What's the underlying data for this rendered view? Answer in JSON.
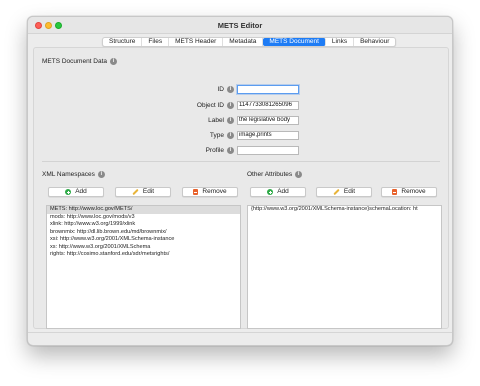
{
  "window": {
    "title": "METS Editor"
  },
  "tabs": [
    {
      "label": "Structure",
      "active": false
    },
    {
      "label": "Files",
      "active": false
    },
    {
      "label": "METS Header",
      "active": false
    },
    {
      "label": "Metadata",
      "active": false
    },
    {
      "label": "METS Document",
      "active": true
    },
    {
      "label": "Links",
      "active": false
    },
    {
      "label": "Behaviour",
      "active": false
    }
  ],
  "document_data": {
    "section_label": "METS Document Data",
    "fields": [
      {
        "label": "ID",
        "value": ""
      },
      {
        "label": "Object ID",
        "value": "1147733081265096"
      },
      {
        "label": "Label",
        "value": "the legislative body"
      },
      {
        "label": "Type",
        "value": "image,prints"
      },
      {
        "label": "Profile",
        "value": ""
      }
    ]
  },
  "xml_namespaces": {
    "section_label": "XML Namespaces",
    "buttons": {
      "add": "Add",
      "edit": "Edit",
      "remove": "Remove"
    },
    "items": [
      "METS: http://www.loc.gov/METS/",
      "mods: http://www.loc.gov/mods/v3",
      "xlink: http://www.w3.org/1999/xlink",
      "brownmix: http://dl.lib.brown.edu/md/brownmix/",
      "xsi: http://www.w3.org/2001/XMLSchema-instance",
      "xs: http://www.w3.org/2001/XMLSchema",
      "rights: http://cosimo.stanford.edu/sdr/metsrights/"
    ],
    "selected_index": 0
  },
  "other_attributes": {
    "section_label": "Other Attributes",
    "buttons": {
      "add": "Add",
      "edit": "Edit",
      "remove": "Remove"
    },
    "items": [
      "{http://www.w3.org/2001/XMLSchema-instance}schemaLocation: ht"
    ]
  },
  "info_icon_glyph": "i",
  "colors": {
    "accent": "#1e7cf5",
    "add_icon": "#2faa48",
    "edit_icon": "#e8b43a",
    "remove_icon": "#e8622c",
    "close": "#fe5f57",
    "minimize": "#febc2e",
    "maximize": "#28c840"
  }
}
